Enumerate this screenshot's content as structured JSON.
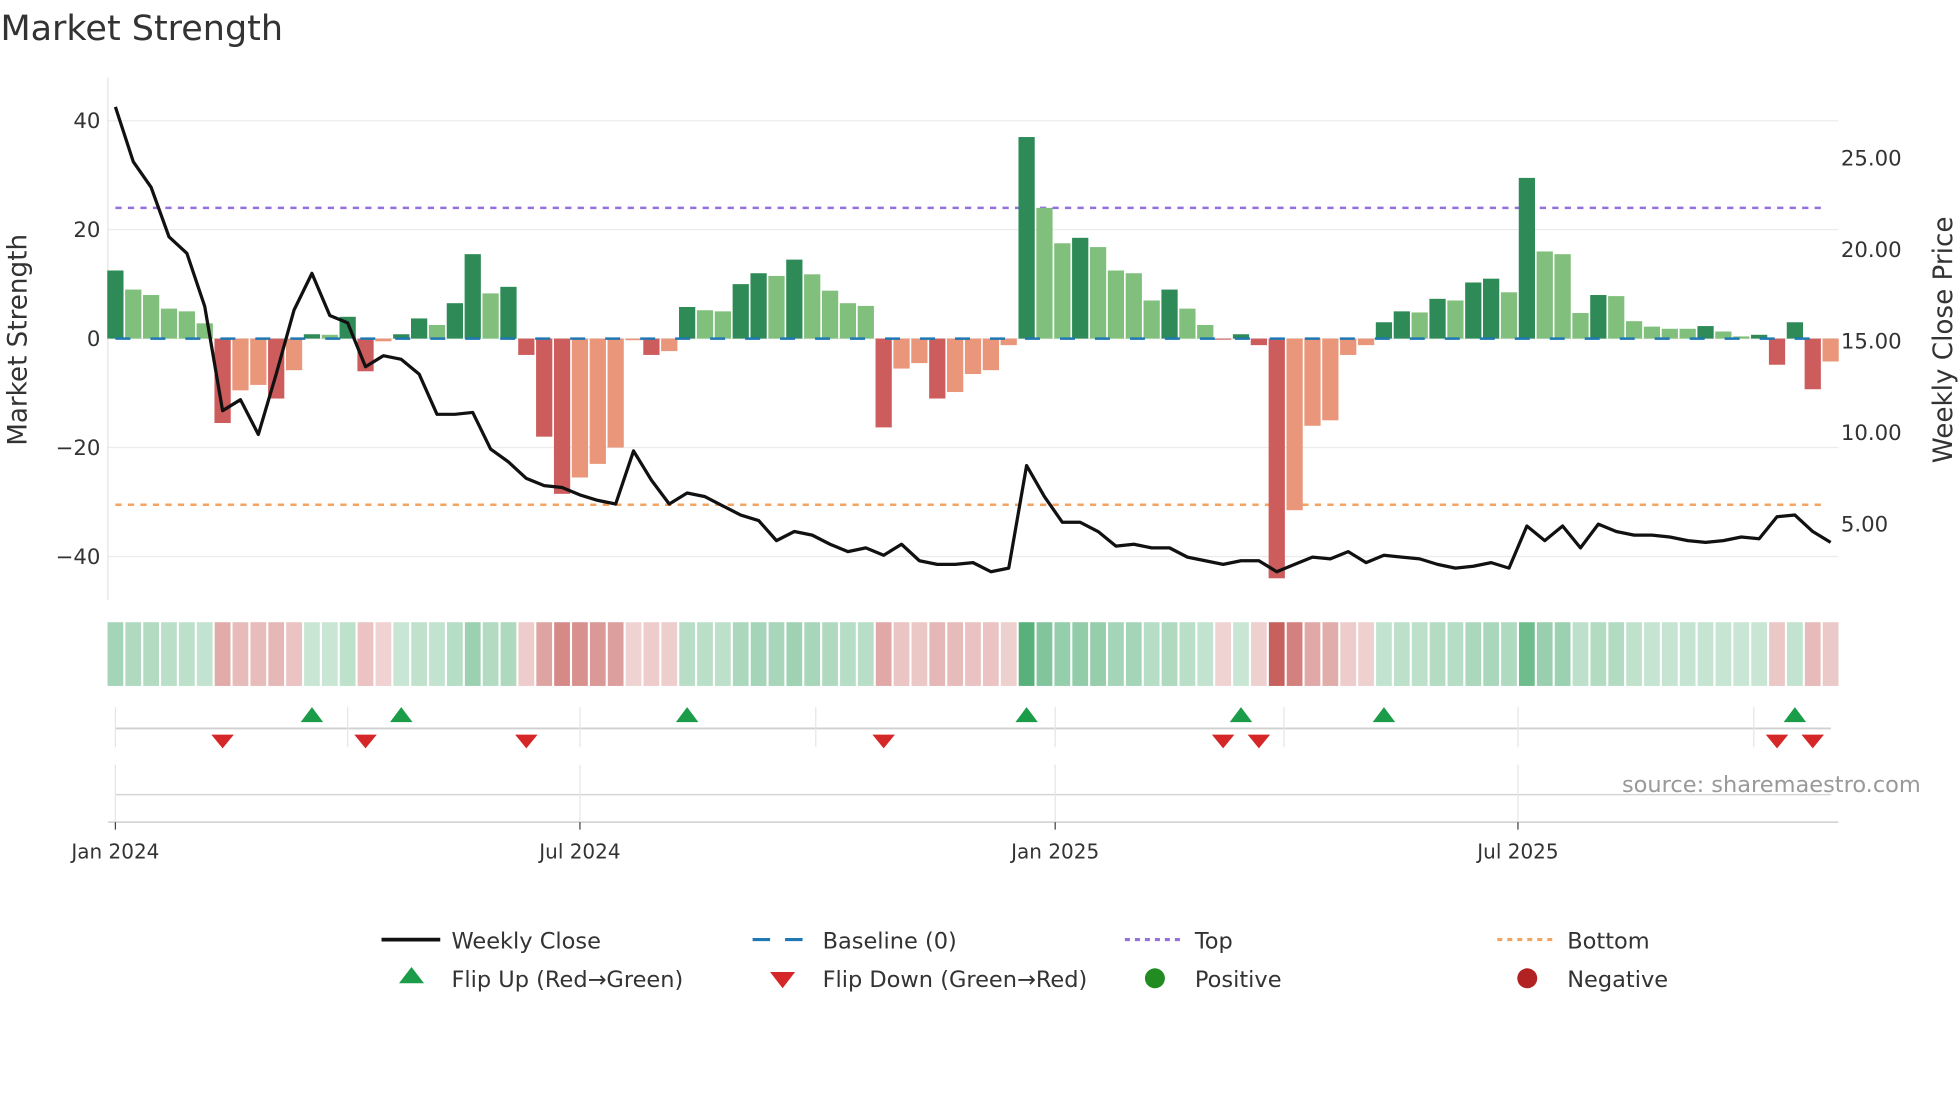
{
  "chart_data": {
    "type": "bar",
    "title": "Market Strength",
    "ylabel": "Market Strength",
    "y2label": "Weekly Close Price",
    "ylim": [
      -48,
      48
    ],
    "y2lim": [
      1.2,
      28.6
    ],
    "yticks": [
      {
        "v": 40,
        "label": "40"
      },
      {
        "v": 20,
        "label": "20"
      },
      {
        "v": 0,
        "label": "0"
      },
      {
        "v": -20,
        "label": "−20"
      },
      {
        "v": -40,
        "label": "−40"
      }
    ],
    "y2ticks": [
      {
        "v": 25,
        "label": "25.00"
      },
      {
        "v": 20,
        "label": "20.00"
      },
      {
        "v": 15,
        "label": "15.00"
      },
      {
        "v": 10,
        "label": "10.00"
      },
      {
        "v": 5,
        "label": "5.00"
      }
    ],
    "xticks": [
      {
        "week": 0,
        "label": "Jan 2024"
      },
      {
        "week": 26,
        "label": "Jul 2024"
      },
      {
        "week": 52.6,
        "label": "Jan 2025"
      },
      {
        "week": 78.5,
        "label": "Jul 2025"
      }
    ],
    "quarter_gridlines_weeks": [
      0,
      13,
      26,
      39.2,
      52.6,
      65.4,
      78.5,
      91.7
    ],
    "top_level": 24,
    "bottom_level": -30.5,
    "baseline": 0,
    "strength": [
      12.5,
      9,
      8,
      5.5,
      5,
      2.8,
      -15.5,
      -9.5,
      -8.5,
      -11,
      -5.8,
      0.8,
      0.7,
      4,
      -6,
      -0.5,
      0.8,
      3.7,
      2.5,
      6.5,
      15.5,
      8.3,
      9.5,
      -3,
      -18,
      -28.5,
      -25.5,
      -23,
      -20,
      -0.3,
      -3,
      -2.3,
      5.8,
      5.2,
      5,
      10,
      12,
      11.5,
      14.5,
      11.8,
      8.8,
      6.5,
      6,
      -16.3,
      -5.5,
      -4.5,
      -11,
      -9.8,
      -6.5,
      -5.8,
      -1.2,
      37,
      24,
      17.5,
      18.5,
      16.8,
      12.5,
      12,
      7,
      9,
      5.5,
      2.5,
      -0.2,
      0.8,
      -1.2,
      -44,
      -31.5,
      -16,
      -15,
      -3,
      -1.2,
      3,
      5,
      4.8,
      7.3,
      7,
      10.3,
      11,
      8.5,
      29.5,
      16,
      15.5,
      4.7,
      8,
      7.8,
      3.2,
      2.2,
      1.8,
      1.8,
      2.3,
      1.3,
      0.4,
      0.7,
      -4.8,
      3,
      -9.3,
      -4.2
    ],
    "weekly_close": [
      27.8,
      24.8,
      23.4,
      20.7,
      19.8,
      16.9,
      11.2,
      11.8,
      9.9,
      13.2,
      16.7,
      18.7,
      16.4,
      16.0,
      13.6,
      14.2,
      14.0,
      13.2,
      11.0,
      11.0,
      11.1,
      9.1,
      8.4,
      7.5,
      7.1,
      7.0,
      6.6,
      6.3,
      6.1,
      9.0,
      7.4,
      6.1,
      6.7,
      6.5,
      6.0,
      5.5,
      5.2,
      4.1,
      4.6,
      4.4,
      3.9,
      3.5,
      3.7,
      3.3,
      3.9,
      3.0,
      2.8,
      2.8,
      2.9,
      2.4,
      2.6,
      8.2,
      6.5,
      5.1,
      5.1,
      4.6,
      3.8,
      3.9,
      3.7,
      3.7,
      3.2,
      3.0,
      2.8,
      3.0,
      3.0,
      2.4,
      2.8,
      3.2,
      3.1,
      3.5,
      2.9,
      3.3,
      3.2,
      3.1,
      2.8,
      2.6,
      2.7,
      2.9,
      2.6,
      4.9,
      4.1,
      4.9,
      3.7,
      5.0,
      4.6,
      4.4,
      4.4,
      4.3,
      4.1,
      4.0,
      4.1,
      4.3,
      4.2,
      5.4,
      5.5,
      4.6,
      4.0
    ],
    "colors": {
      "pos_strong": "#2e8b57",
      "pos_weak": "#81c07c",
      "neg_strong": "#cd5c5c",
      "neg_weak": "#e9967a",
      "close": "#111111",
      "baseline": "#1f77b4",
      "top": "#9370db",
      "bottom": "#f4a460",
      "flip_up": "#1a9c48",
      "flip_down": "#d62728",
      "positive": "#228b22",
      "negative": "#b22222",
      "heat_pos": "#2e9e5a",
      "heat_neg": "#c0504d"
    },
    "legend": [
      {
        "key": "close",
        "label": "Weekly Close",
        "kind": "line"
      },
      {
        "key": "baseline",
        "label": "Baseline (0)",
        "kind": "dash"
      },
      {
        "key": "top",
        "label": "Top",
        "kind": "dot"
      },
      {
        "key": "bottom",
        "label": "Bottom",
        "kind": "dot"
      },
      {
        "key": "flip_up",
        "label": "Flip Up (Red→Green)",
        "kind": "up"
      },
      {
        "key": "flip_down",
        "label": "Flip Down (Green→Red)",
        "kind": "down"
      },
      {
        "key": "positive",
        "label": "Positive",
        "kind": "circle"
      },
      {
        "key": "negative",
        "label": "Negative",
        "kind": "circle"
      }
    ],
    "legend_position": "bottom-center",
    "source": "source: sharemaestro.com"
  }
}
